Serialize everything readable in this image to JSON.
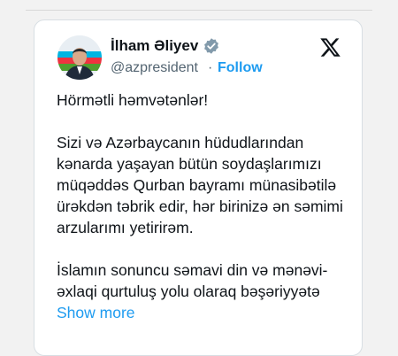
{
  "tweet": {
    "author_name": "İlham Əliyev",
    "handle": "@azpresident",
    "separator": "·",
    "follow_label": "Follow",
    "paragraphs": [
      "Hörmətli həmvətənlər!",
      "Sizi və Azərbaycanın hüdudlarından kənarda yaşayan bütün soydaşlarımızı müqəddəs Qurban bayramı münasibətilə ürəkdən təbrik edir, hər birinizə ən səmimi arzularımı yetirirəm.",
      "İslamın sonuncu səmavi din və mənəvi-əxlaqi qurtuluş yolu olaraq bəşəriyyətə"
    ],
    "show_more_label": "Show more"
  },
  "colors": {
    "accent": "#1d9bf0",
    "text": "#0f1419",
    "muted": "#536471",
    "card_border": "#d8dee3",
    "page_bg": "#f2f2f2"
  },
  "icons": {
    "verified": "verified-badge-icon",
    "x_logo": "x-logo-icon"
  }
}
